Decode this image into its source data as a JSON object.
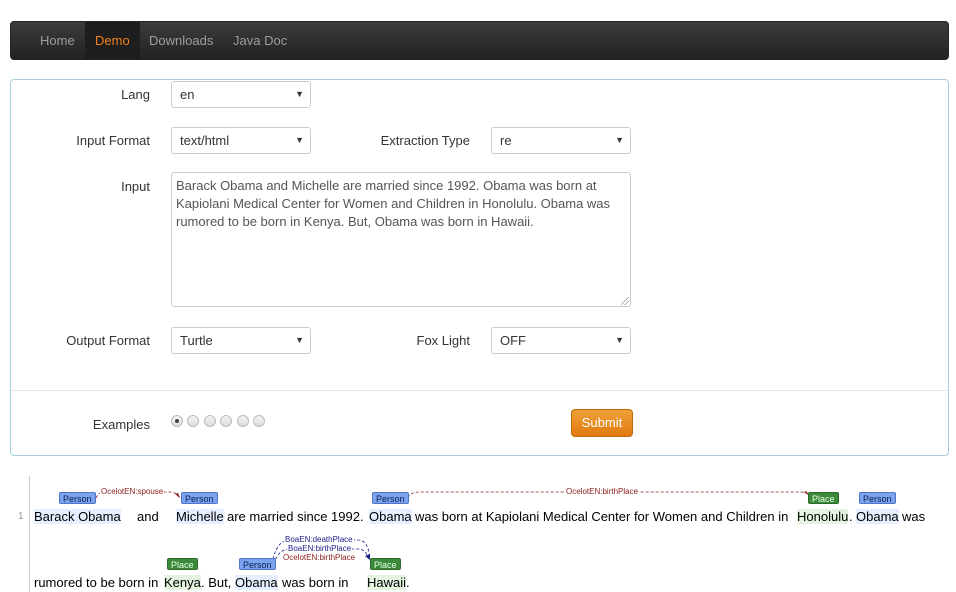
{
  "nav": {
    "items": [
      "Home",
      "Demo",
      "Downloads",
      "Java Doc"
    ],
    "active": "Demo",
    "active_color": "#f0801a"
  },
  "form": {
    "lang_label": "Lang",
    "lang_value": "en",
    "input_format_label": "Input Format",
    "input_format_value": "text/html",
    "extraction_type_label": "Extraction Type",
    "extraction_type_value": "re",
    "input_label": "Input",
    "input_value": "Barack Obama and Michelle are married since 1992. Obama was born at Kapiolani Medical Center for Women and Children in Honolulu. Obama was rumored to be born in Kenya. But, Obama was born in Hawaii.",
    "output_format_label": "Output Format",
    "output_format_value": "Turtle",
    "fox_light_label": "Fox Light",
    "fox_light_value": "OFF",
    "examples_label": "Examples",
    "examples_count": 6,
    "examples_selected": 1,
    "submit_label": "Submit"
  },
  "annotation": {
    "line_number": "1",
    "line1": [
      "Barack Obama",
      "and",
      "Michelle",
      "are married since 1992.",
      "Obama",
      "was born at Kapiolani Medical Center for Women and Children in",
      "Honolulu",
      ".",
      "Obama",
      "was"
    ],
    "line2": [
      "rumored to be born in",
      "Kenya",
      ". But,",
      "Obama",
      "was born in",
      "Hawaii",
      "."
    ],
    "entity_tags": {
      "person": "Person",
      "place": "Place"
    },
    "relations": [
      "OcelotEN:spouse",
      "OcelotEN:birthPlace",
      "BoaEN:deathPlace",
      "BoaEN:birthPlace",
      "OcelotEN:birthPlace"
    ],
    "colors": {
      "person_tag": "#7ca4ee",
      "place_tag": "#3a8a3a",
      "relation_ocelot": "#8a1c1c",
      "relation_boa": "#1c1c8a"
    }
  }
}
